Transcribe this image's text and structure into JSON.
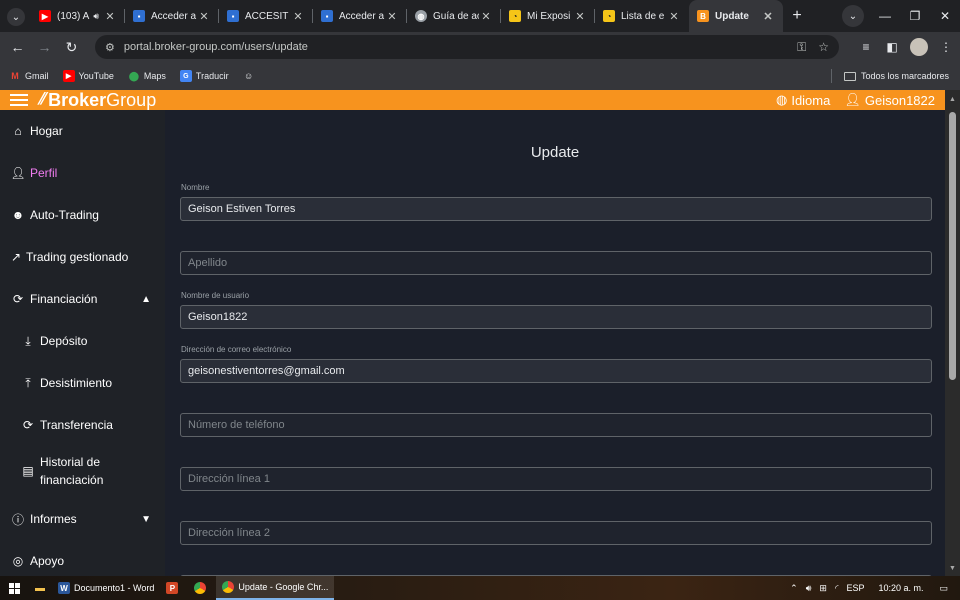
{
  "browser": {
    "tabs": [
      {
        "title": "(103) A",
        "favicon": "youtube-icon",
        "color": "#ff0000",
        "audio": true
      },
      {
        "title": "Acceder a",
        "favicon": "site-icon",
        "color": "#2f6fd1"
      },
      {
        "title": "ACCESIT -",
        "favicon": "site-icon",
        "color": "#2f6fd1"
      },
      {
        "title": "Acceder a",
        "favicon": "site-icon",
        "color": "#2f6fd1"
      },
      {
        "title": "Guía de ac",
        "favicon": "globe-icon",
        "color": "#9aa0a6"
      },
      {
        "title": "Mi Exposi",
        "favicon": "site-icon",
        "color": "#f5c518"
      },
      {
        "title": "Lista de e",
        "favicon": "site-icon",
        "color": "#f5c518"
      },
      {
        "title": "Update",
        "favicon": "brokergroup-icon",
        "color": "#f7931e",
        "active": true
      }
    ],
    "url": "portal.broker-group.com/users/update",
    "bookmarks": [
      {
        "label": "Gmail",
        "icon": "gmail-icon",
        "color": "#ea4335"
      },
      {
        "label": "YouTube",
        "icon": "youtube-icon",
        "color": "#ff0000"
      },
      {
        "label": "Maps",
        "icon": "maps-icon",
        "color": "#34a853"
      },
      {
        "label": "Traducir",
        "icon": "translate-icon",
        "color": "#4285f4"
      },
      {
        "label": "",
        "icon": "extension-icon",
        "color": "#e8eaed"
      }
    ],
    "all_bookmarks": "Todos los marcadores"
  },
  "site": {
    "brand_part1": "Broker",
    "brand_part2": "Group",
    "language": "Idioma",
    "username": "Geison1822",
    "accent": "#f7931e"
  },
  "sidebar": {
    "items": [
      {
        "label": "Hogar",
        "icon": "home-icon"
      },
      {
        "label": "Perfil",
        "icon": "user-icon",
        "active": true
      },
      {
        "label": "Auto-Trading",
        "icon": "robot-icon"
      },
      {
        "label": "Trading gestionado",
        "icon": "trend-icon"
      },
      {
        "label": "Financiación",
        "icon": "exchange-icon",
        "expanded": true
      },
      {
        "label": "Depósito",
        "icon": "download-icon"
      },
      {
        "label": "Desistimiento",
        "icon": "upload-icon"
      },
      {
        "label": "Transferencia",
        "icon": "exchange-icon"
      },
      {
        "label": "Historial de",
        "label2": "financiación",
        "icon": "document-icon"
      },
      {
        "label": "Informes",
        "icon": "info-icon"
      },
      {
        "label": "Apoyo",
        "icon": "support-icon"
      }
    ]
  },
  "form": {
    "title": "Update",
    "fields": [
      {
        "label": "Nombre",
        "value": "Geison Estiven Torres",
        "placeholder": ""
      },
      {
        "label": "",
        "value": "",
        "placeholder": "Apellido"
      },
      {
        "label": "Nombre de usuario",
        "value": "Geison1822",
        "placeholder": ""
      },
      {
        "label": "Dirección de correo electrónico",
        "value": "geisonestiventorres@gmail.com",
        "placeholder": ""
      },
      {
        "label": "",
        "value": "",
        "placeholder": "Número de teléfono"
      },
      {
        "label": "",
        "value": "",
        "placeholder": "Dirección línea 1"
      },
      {
        "label": "",
        "value": "",
        "placeholder": "Dirección línea 2"
      }
    ]
  },
  "taskbar": {
    "apps": [
      {
        "label": "Documento1 - Word",
        "icon": "word-icon",
        "color": "#2b579a"
      },
      {
        "label": "",
        "icon": "powerpoint-icon",
        "color": "#d24726"
      },
      {
        "label": "",
        "icon": "chrome-icon",
        "color": "#34a853"
      },
      {
        "label": "Update - Google Chr...",
        "icon": "chrome-icon",
        "color": "#fbbc05",
        "open": true
      }
    ],
    "language": "ESP",
    "time": "10:20 a. m."
  }
}
